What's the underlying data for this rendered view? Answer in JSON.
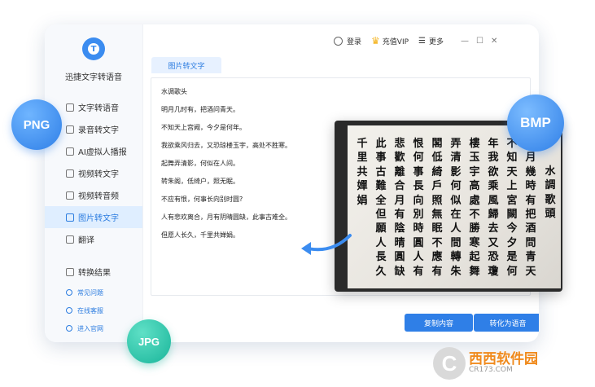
{
  "app": {
    "name": "迅捷文字转语音",
    "logo_letter": "T"
  },
  "sidebar": {
    "items": [
      {
        "label": "文字转语音",
        "icon": "text-icon",
        "active": false
      },
      {
        "label": "录音转文字",
        "icon": "record-icon",
        "active": false
      },
      {
        "label": "AI虚拟人播报",
        "icon": "ai-icon",
        "active": false
      },
      {
        "label": "视频转文字",
        "icon": "video-icon",
        "active": false
      },
      {
        "label": "视频转音频",
        "icon": "video-audio-icon",
        "active": false
      },
      {
        "label": "图片转文字",
        "icon": "image-icon",
        "active": true
      },
      {
        "label": "翻译",
        "icon": "translate-icon",
        "active": false
      }
    ],
    "result": {
      "label": "转换结果",
      "icon": "result-icon"
    },
    "help": [
      {
        "label": "常见问题",
        "icon": "question-icon"
      },
      {
        "label": "在线客服",
        "icon": "service-icon"
      },
      {
        "label": "进入官网",
        "icon": "website-icon"
      }
    ]
  },
  "topbar": {
    "login": "登录",
    "vip": "充值VIP",
    "more": "更多",
    "minimize": "—",
    "maximize": "☐",
    "close": "✕"
  },
  "tab": {
    "label": "图片转文字"
  },
  "content": {
    "lines": [
      "水调歌头",
      "明月几时有，把酒问青天。",
      "不知天上宫阙，今夕是何年。",
      "我欲乘风归去，又恐琼楼玉宇，高处不胜寒。",
      "起舞弄清影，何似在人间。",
      "转朱阁，低绮户，照无眠。",
      "不应有恨，何事长向别时圆?",
      "人有悲欢离合，月有阴晴圆缺，此事古难全。",
      "但愿人长久，千里共婵娟。"
    ]
  },
  "buttons": {
    "copy": "复制内容",
    "to_speech": "转化为语音"
  },
  "photo": {
    "columns": [
      "水調歌頭",
      "明月幾時有把酒問青天",
      "不知天上宮闕今夕是何",
      "年我欲乘風歸去又恐瓊",
      "樓玉宇高處不勝寒起舞",
      "弄清影何似在人間轉朱",
      "閣低綺戶照無眠不應有",
      "恨何事長向別時圓人有",
      "悲歡離合月有陰晴圓缺",
      "此事古難全但願人長久",
      "千里共嬋娟"
    ]
  },
  "badges": {
    "png": "PNG",
    "bmp": "BMP",
    "jpg": "JPG"
  },
  "watermark": {
    "main": "西西软件园",
    "sub": "CR173.COM"
  },
  "colors": {
    "accent": "#2f7fe7",
    "active_bg": "#dfeeff",
    "vip": "#f4b21a",
    "jpg_badge": "#19b59a"
  }
}
